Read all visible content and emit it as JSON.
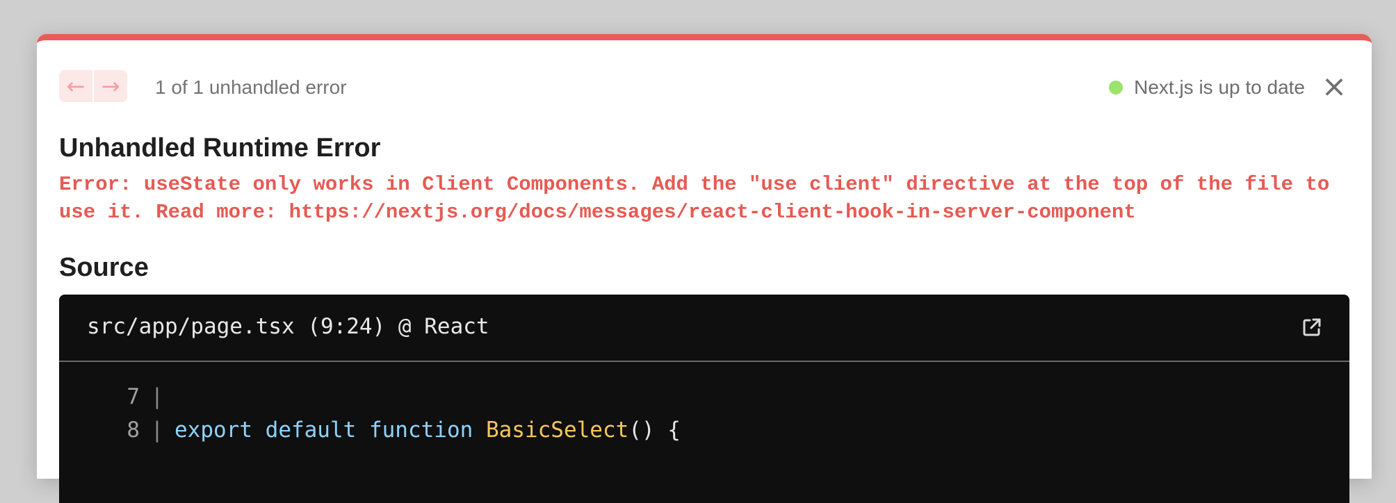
{
  "nav": {
    "prev_icon": "←",
    "next_icon": "→"
  },
  "header": {
    "error_count": "1 of 1 unhandled error",
    "version_status": "Next.js is up to date",
    "close_icon": "×"
  },
  "error": {
    "title": "Unhandled Runtime Error",
    "message": "Error: useState only works in Client Components. Add the \"use client\" directive at the top of the file to use it. Read more: https://nextjs.org/docs/messages/react-client-hook-in-server-component"
  },
  "source": {
    "heading": "Source",
    "file_location": "src/app/page.tsx (9:24) @ React",
    "lines": [
      {
        "number": "7",
        "gutter": "|",
        "tokens": []
      },
      {
        "number": "8",
        "gutter": "|",
        "tokens": [
          {
            "kind": "kw",
            "text": "export"
          },
          {
            "kind": "plain",
            "text": " "
          },
          {
            "kind": "kw",
            "text": "default"
          },
          {
            "kind": "plain",
            "text": " "
          },
          {
            "kind": "kw",
            "text": "function"
          },
          {
            "kind": "plain",
            "text": " "
          },
          {
            "kind": "fn",
            "text": "BasicSelect"
          },
          {
            "kind": "plain",
            "text": "() {"
          }
        ]
      }
    ]
  },
  "colors": {
    "accent_red": "#e95d57",
    "status_green": "#9ce36d",
    "code_background": "#0f0f0f",
    "keyword_blue": "#8ed3ff",
    "function_yellow": "#f5c85b"
  },
  "icons": {
    "status": "status-dot-icon",
    "open_in_editor": "external-link-icon"
  }
}
